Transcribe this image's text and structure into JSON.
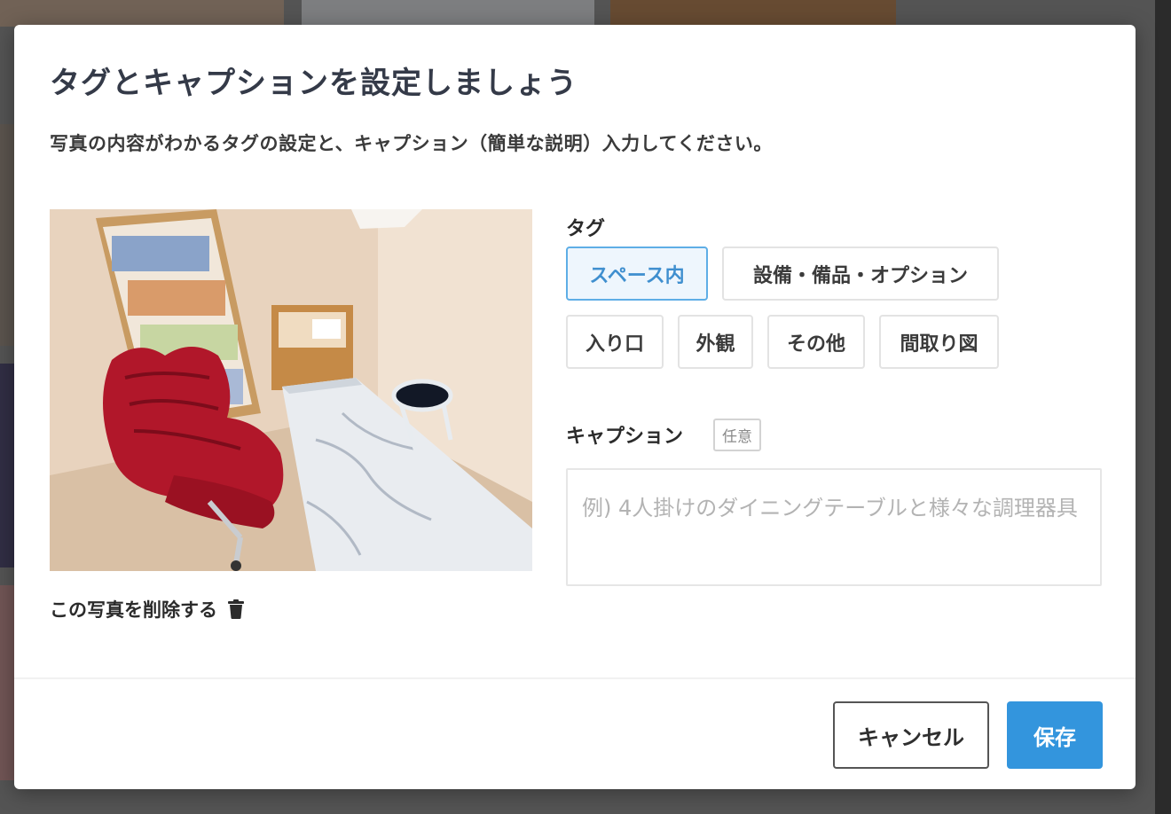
{
  "modal": {
    "title": "タグとキャプションを設定しましょう",
    "description": "写真の内容がわかるタグの設定と、キャプション（簡単な説明）入力してください。"
  },
  "photo": {
    "delete_label": "この写真を削除する",
    "delete_icon": "trash-icon"
  },
  "tags": {
    "label": "タグ",
    "rows": [
      [
        {
          "label": "スペース内",
          "selected": true
        },
        {
          "label": "設備・備品・オプション",
          "selected": false
        }
      ],
      [
        {
          "label": "入り口",
          "selected": false
        },
        {
          "label": "外観",
          "selected": false
        },
        {
          "label": "その他",
          "selected": false
        },
        {
          "label": "間取り図",
          "selected": false
        }
      ]
    ]
  },
  "caption": {
    "label": "キャプション",
    "badge": "任意",
    "value": "",
    "placeholder": "例) 4人掛けのダイニングテーブルと様々な調理器具"
  },
  "footer": {
    "cancel_label": "キャンセル",
    "save_label": "保存"
  },
  "colors": {
    "accent": "#3395dd",
    "selected_tag_border": "#5eaee6",
    "selected_tag_bg": "#eef6fd",
    "title_text": "#343a48"
  }
}
